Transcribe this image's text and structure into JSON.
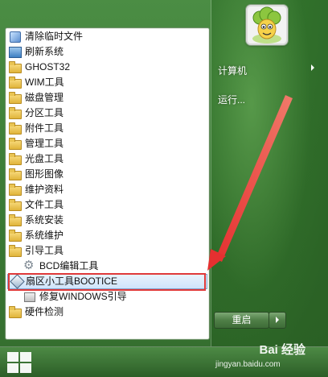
{
  "start_menu": {
    "programs": [
      {
        "label": "清除临时文件",
        "icon": "cleanup-icon",
        "type": "app"
      },
      {
        "label": "刷新系统",
        "icon": "refresh-icon",
        "type": "app"
      },
      {
        "label": "GHOST32",
        "icon": "folder-icon",
        "type": "folder"
      },
      {
        "label": "WIM工具",
        "icon": "folder-icon",
        "type": "folder"
      },
      {
        "label": "磁盘管理",
        "icon": "folder-icon",
        "type": "folder"
      },
      {
        "label": "分区工具",
        "icon": "folder-icon",
        "type": "folder"
      },
      {
        "label": "附件工具",
        "icon": "folder-icon",
        "type": "folder"
      },
      {
        "label": "管理工具",
        "icon": "folder-icon",
        "type": "folder"
      },
      {
        "label": "光盘工具",
        "icon": "folder-icon",
        "type": "folder"
      },
      {
        "label": "图形图像",
        "icon": "folder-icon",
        "type": "folder"
      },
      {
        "label": "维护资料",
        "icon": "folder-icon",
        "type": "folder"
      },
      {
        "label": "文件工具",
        "icon": "folder-icon",
        "type": "folder"
      },
      {
        "label": "系统安装",
        "icon": "folder-icon",
        "type": "folder"
      },
      {
        "label": "系统维护",
        "icon": "folder-icon",
        "type": "folder"
      },
      {
        "label": "引导工具",
        "icon": "folder-icon",
        "type": "folder"
      },
      {
        "label": "BCD编辑工具",
        "icon": "gear-icon",
        "type": "sub"
      },
      {
        "label": "扇区小工具BOOTICE",
        "icon": "bootice-icon",
        "type": "sub-selected"
      },
      {
        "label": "修复WINDOWS引导",
        "icon": "repair-box-icon",
        "type": "sub"
      },
      {
        "label": "硬件检测",
        "icon": "folder-icon",
        "type": "folder"
      }
    ],
    "right_pane": {
      "computer_label": "计算机",
      "run_label": "运行..."
    },
    "shutdown_label": "重启"
  },
  "watermark": {
    "brand": "Bai 经验",
    "url": "jingyan.baidu.com"
  },
  "colors": {
    "background": "#3a7a34",
    "highlight_box": "#e03a3a",
    "arrow": "#e53030",
    "selected_bg": "#cfe4fb"
  }
}
